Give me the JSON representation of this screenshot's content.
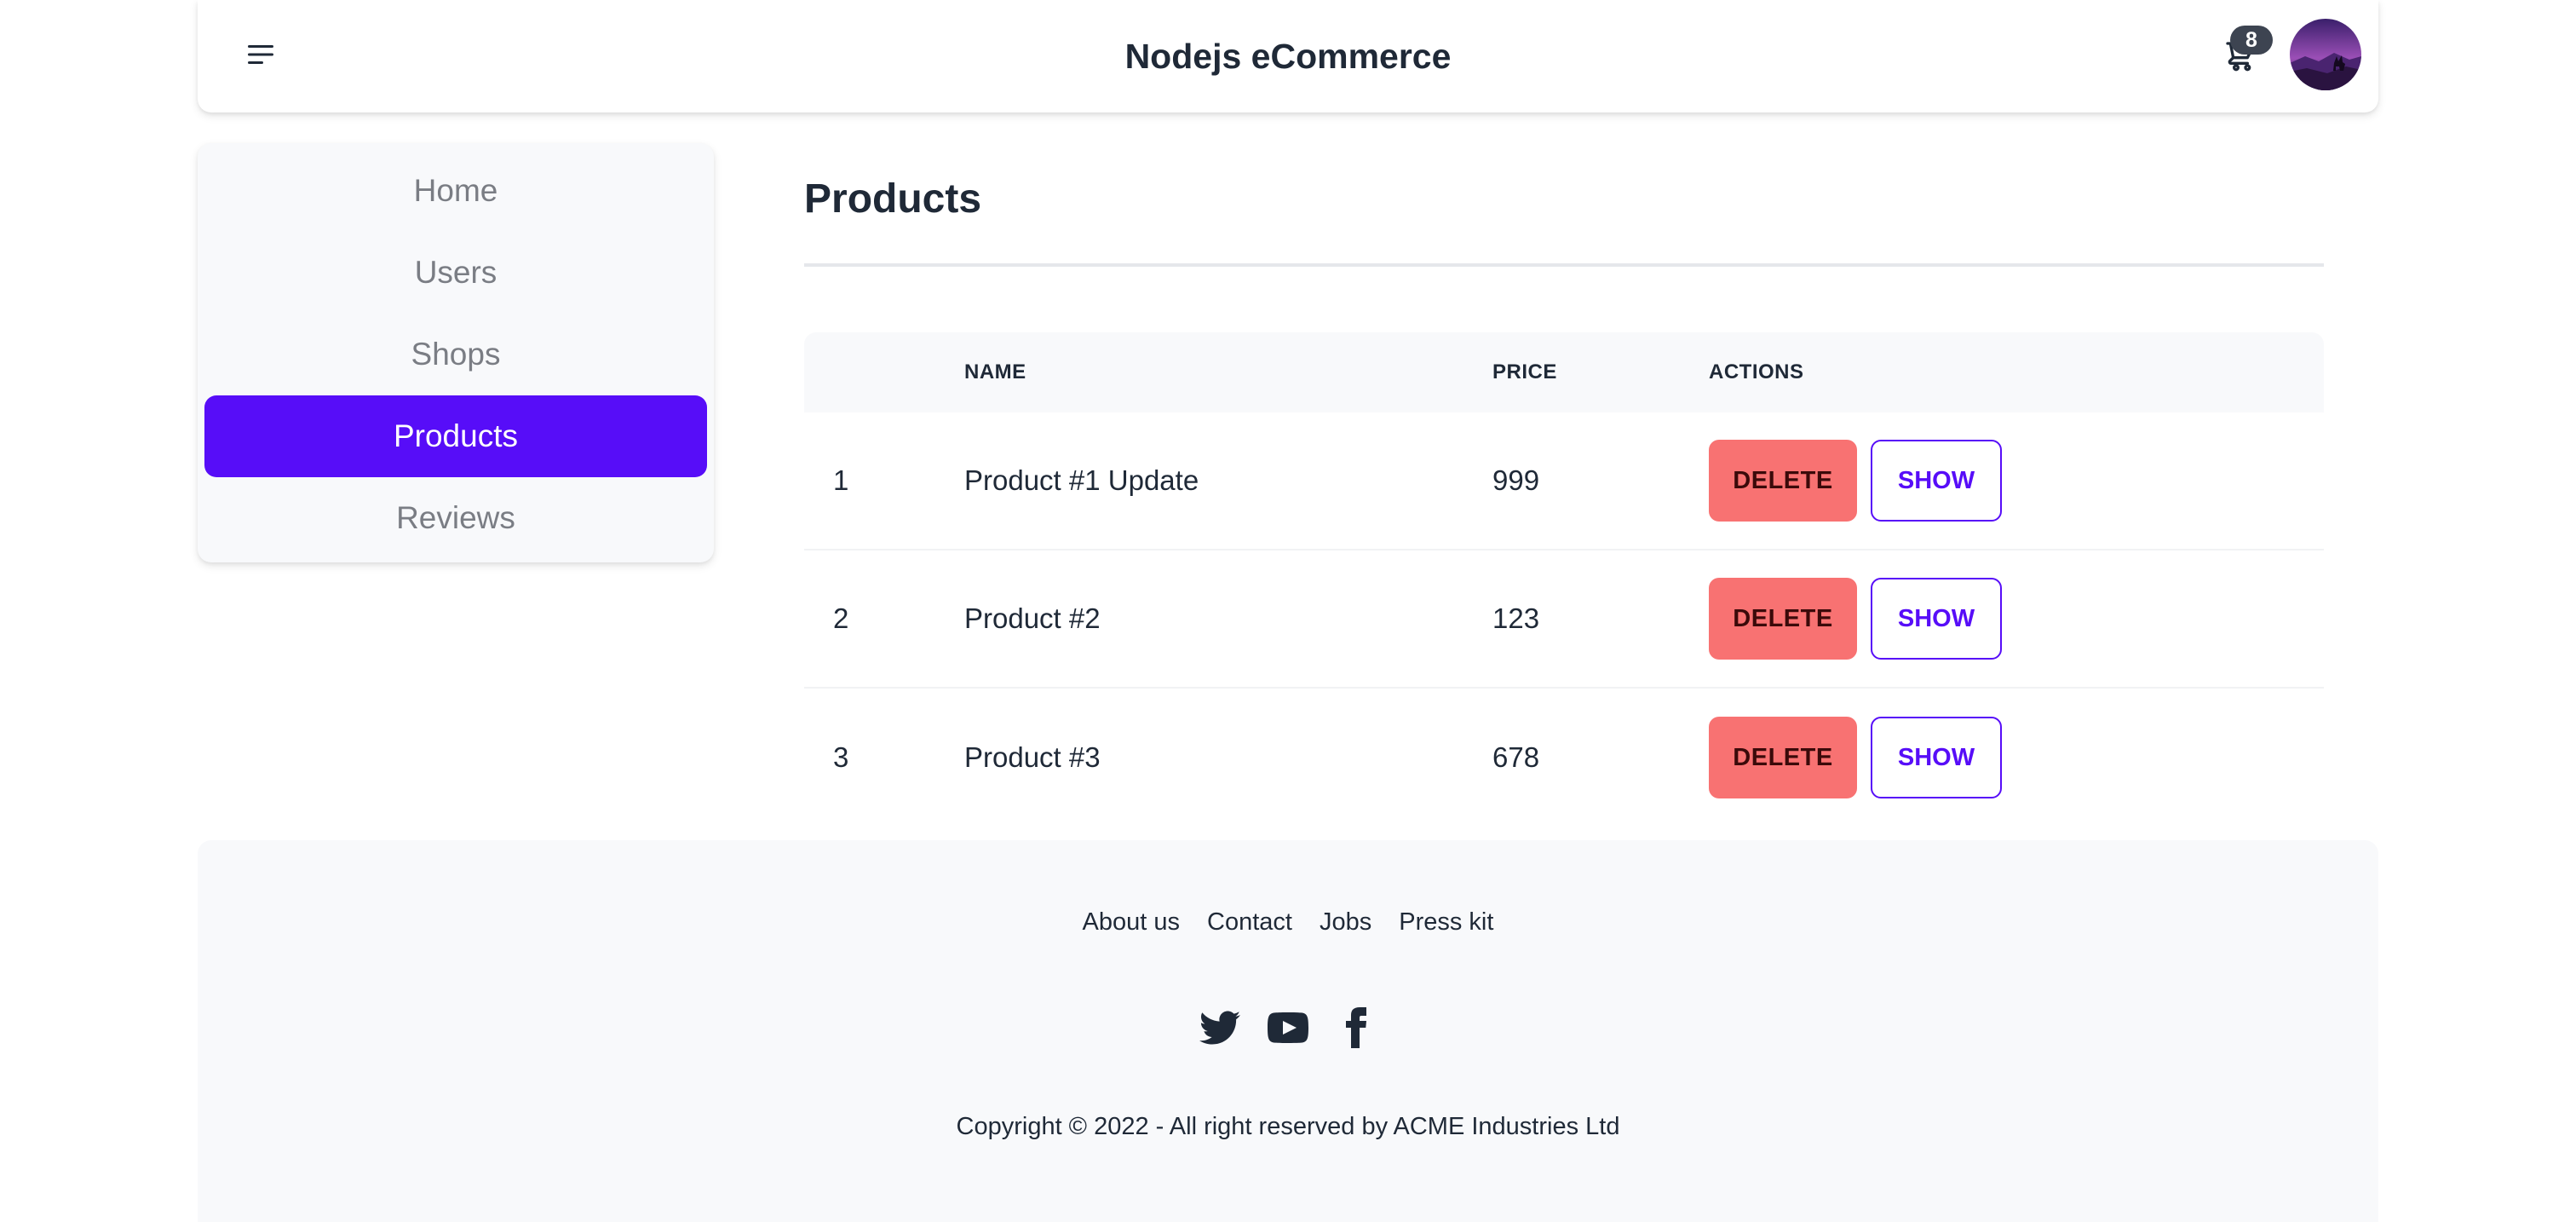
{
  "colors": {
    "primary": "#570df8",
    "error": "#f87272",
    "neutral": "#3d4451",
    "base_light": "#f8f9fb",
    "text": "#1f2937"
  },
  "navbar": {
    "title": "Nodejs eCommerce",
    "menu_icon": "menu-icon",
    "cart_icon": "shopping-cart-icon",
    "cart_count": "8",
    "avatar": "user-avatar"
  },
  "sidebar": {
    "items": [
      {
        "label": "Home",
        "active": false
      },
      {
        "label": "Users",
        "active": false
      },
      {
        "label": "Shops",
        "active": false
      },
      {
        "label": "Products",
        "active": true
      },
      {
        "label": "Reviews",
        "active": false
      }
    ]
  },
  "main": {
    "title": "Products",
    "table": {
      "headers": [
        "",
        "NAME",
        "PRICE",
        "ACTIONS"
      ],
      "rows": [
        {
          "num": "1",
          "name": "Product #1 Update",
          "price": "999"
        },
        {
          "num": "2",
          "name": "Product #2",
          "price": "123"
        },
        {
          "num": "3",
          "name": "Product #3",
          "price": "678"
        }
      ],
      "delete_label": "DELETE",
      "show_label": "SHOW"
    }
  },
  "footer": {
    "links": [
      "About us",
      "Contact",
      "Jobs",
      "Press kit"
    ],
    "social_icons": [
      "twitter-icon",
      "youtube-icon",
      "facebook-icon"
    ],
    "copyright": "Copyright © 2022 - All right reserved by ACME Industries Ltd"
  }
}
